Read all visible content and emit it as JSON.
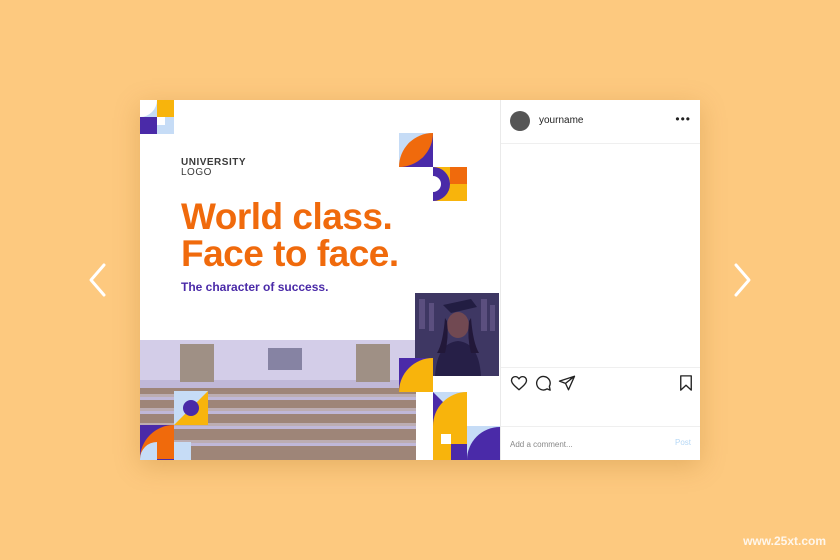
{
  "creative": {
    "logo_line1": "UNIVERSITY",
    "logo_line2": "LOGO",
    "headline_line1": "World class.",
    "headline_line2": "Face to face.",
    "tagline": "The character of success."
  },
  "instagram": {
    "username": "yourname",
    "more_label": "•••",
    "comment_placeholder": "Add a comment...",
    "post_label": "Post"
  },
  "watermark": "www.25xt.com",
  "colors": {
    "background": "#fdc97f",
    "orange": "#f06a0c",
    "purple": "#4a2aa8",
    "yellow": "#f8b40c",
    "light_blue": "#c6dcf6"
  },
  "icons": {
    "prev": "chevron-left-icon",
    "next": "chevron-right-icon",
    "like": "heart-icon",
    "comment": "comment-icon",
    "share": "send-icon",
    "save": "bookmark-icon"
  }
}
